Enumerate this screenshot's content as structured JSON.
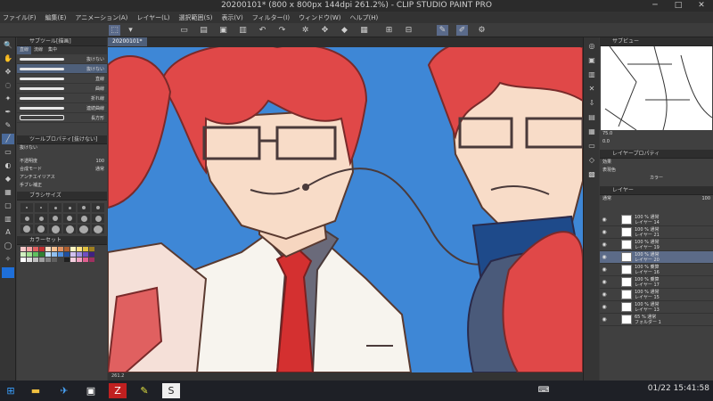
{
  "window": {
    "title": "20200101* (800 x 800px 144dpi 261.2%) - CLIP STUDIO PAINT PRO",
    "min": "─",
    "max": "□",
    "close": "✕"
  },
  "menu": [
    "ファイル(F)",
    "編集(E)",
    "アニメーション(A)",
    "レイヤー(L)",
    "選択範囲(S)",
    "表示(V)",
    "フィルター(I)",
    "ウィンドウ(W)",
    "ヘルプ(H)"
  ],
  "toolbar": {
    "icons": [
      "new-icon",
      "open-icon",
      "save-icon",
      "undo-icon",
      "redo-icon",
      "clear-icon",
      "transform-icon",
      "fill-icon",
      "brush-icon"
    ]
  },
  "tool_panel": {
    "header": "サブツール[描画]",
    "tabs": [
      "直線",
      "流線",
      "集中"
    ],
    "brushes": [
      {
        "name": "抜けない",
        "selected": false
      },
      {
        "name": "抜けない",
        "selected": true
      },
      {
        "name": "直線",
        "selected": false
      },
      {
        "name": "曲線",
        "selected": false
      },
      {
        "name": "折れ線",
        "selected": false
      },
      {
        "name": "連続曲線",
        "selected": false
      },
      {
        "name": "長方形",
        "selected": false
      }
    ]
  },
  "tool_property": {
    "header": "ツールプロパティ[抜けない]",
    "brush_name": "抜けない",
    "rows": [
      {
        "label": "不透明度",
        "value": "100"
      },
      {
        "label": "合成モード",
        "value": "通常"
      },
      {
        "label": "アンチエイリアス",
        "value": ""
      },
      {
        "label": "手ブレ補正",
        "value": ""
      }
    ]
  },
  "brush_size": {
    "header": "ブラシサイズ"
  },
  "color_set": {
    "header": "カラーセット"
  },
  "palette_colors": [
    "#f7c9c9",
    "#f5a3a3",
    "#e06060",
    "#c03030",
    "#f7dcc0",
    "#f5c090",
    "#e09060",
    "#b06030",
    "#fff5c0",
    "#ffe080",
    "#e0c040",
    "#a08020",
    "#d0f0c0",
    "#a0e090",
    "#60c060",
    "#308030",
    "#c0e0f7",
    "#90c0f0",
    "#5090e0",
    "#2050a0",
    "#d0c0f0",
    "#a090e0",
    "#7050c0",
    "#402080",
    "#ffffff",
    "#e0e0e0",
    "#c0c0c0",
    "#a0a0a0",
    "#808080",
    "#606060",
    "#404040",
    "#202020",
    "#f5d0e0",
    "#f0a0c0",
    "#e06090",
    "#a03060"
  ],
  "document": {
    "tab": "20200101*",
    "status": "261.2"
  },
  "subview": {
    "header": "サブビュー",
    "zoom": "75.0",
    "angle": "0.0"
  },
  "layer_property": {
    "header": "レイヤープロパティ",
    "effect": "効果",
    "expression": "表現色",
    "color": "カラー"
  },
  "layers": {
    "header": "レイヤー",
    "blend": "通常",
    "opacity": "100",
    "items": [
      {
        "mode": "100 % 通常",
        "name": "レイヤー 14",
        "selected": false
      },
      {
        "mode": "100 % 通常",
        "name": "レイヤー 21",
        "selected": false
      },
      {
        "mode": "100 % 通常",
        "name": "レイヤー 19",
        "selected": false
      },
      {
        "mode": "100 % 通常",
        "name": "レイヤー 20",
        "selected": true
      },
      {
        "mode": "100 % 乗算",
        "name": "レイヤー 16",
        "selected": false
      },
      {
        "mode": "100 % 乗算",
        "name": "レイヤー 17",
        "selected": false
      },
      {
        "mode": "100 % 通常",
        "name": "レイヤー 15",
        "selected": false
      },
      {
        "mode": "100 % 通常",
        "name": "レイヤー 13",
        "selected": false
      },
      {
        "mode": "65 % 通常",
        "name": "フォルダー 1",
        "selected": false
      }
    ]
  },
  "taskbar": {
    "date": "01/22",
    "time": "15:41:58"
  }
}
